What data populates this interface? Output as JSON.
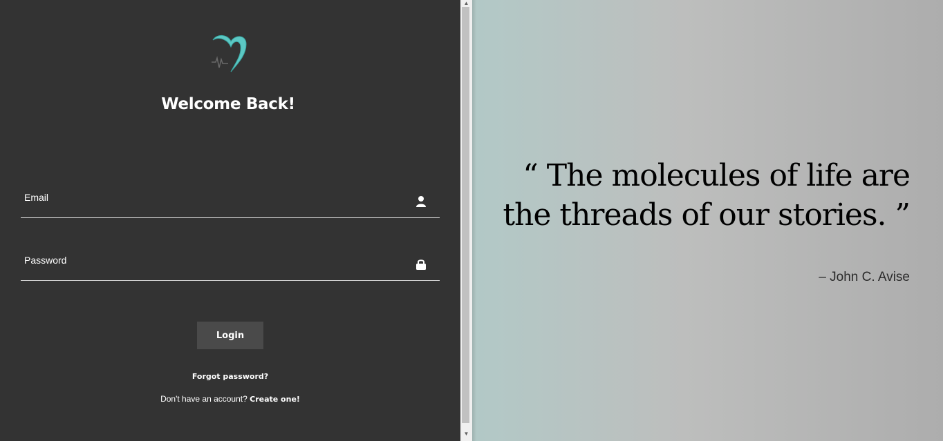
{
  "login": {
    "heading": "Welcome Back!",
    "email_label": "Email",
    "password_label": "Password",
    "login_button": "Login",
    "forgot_password": "Forgot password?",
    "signup_prompt": "Don't have an account?",
    "signup_link": "Create one!"
  },
  "quote": {
    "text": "“ The molecules of life are the threads of our stories. ”",
    "author": "– John C. Avise"
  },
  "icons": {
    "logo": "heart-logo-icon",
    "email": "user-icon",
    "password": "lock-icon",
    "scroll_up": "chevron-up-icon",
    "scroll_down": "chevron-down-icon"
  },
  "colors": {
    "panel_bg": "#333333",
    "button_bg": "#4a4a4a",
    "logo_teal": "#5cc8c4",
    "quote_bg_left": "#b2c9c7",
    "quote_bg_right": "#adadad"
  }
}
